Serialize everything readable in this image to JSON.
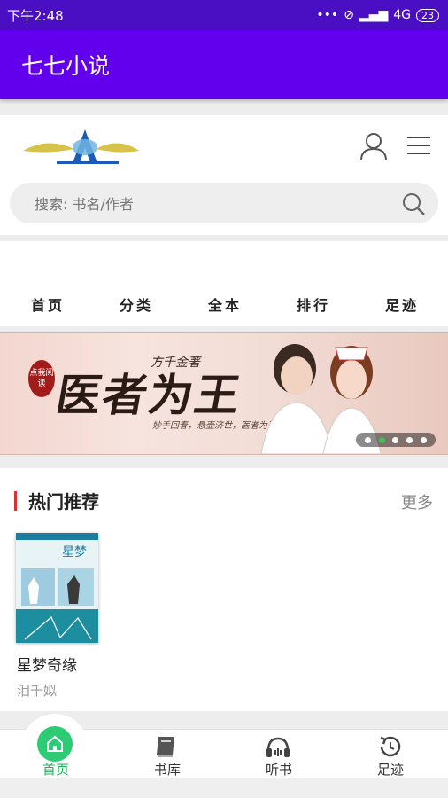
{
  "status_bar": {
    "time": "下午2:48",
    "network": "4G",
    "battery": "23"
  },
  "app_bar": {
    "title": "七七小说"
  },
  "search": {
    "placeholder": "搜索: 书名/作者"
  },
  "nav": {
    "items": [
      {
        "label": "首页"
      },
      {
        "label": "分类"
      },
      {
        "label": "全本"
      },
      {
        "label": "排行"
      },
      {
        "label": "足迹"
      }
    ]
  },
  "banner": {
    "title": "医者为王",
    "author": "方千金著",
    "slogan": "妙手回春，悬壶济世，医者为王",
    "badge": "点我阅读",
    "dot_count": 5,
    "active_dot": 1
  },
  "hot": {
    "title": "热门推荐",
    "more_label": "更多",
    "books": [
      {
        "title": "星梦奇缘",
        "author": "泪千姒"
      }
    ]
  },
  "tab_bar": {
    "items": [
      {
        "label": "首页",
        "icon": "home-icon",
        "active": true
      },
      {
        "label": "书库",
        "icon": "book-icon",
        "active": false
      },
      {
        "label": "听书",
        "icon": "headphones-icon",
        "active": false
      },
      {
        "label": "足迹",
        "icon": "history-icon",
        "active": false
      }
    ],
    "accent_color": "#1fb65a"
  },
  "colors": {
    "status_bar": "#4a0fc2",
    "app_bar": "#6200ee",
    "hot_accent": "#d93232"
  }
}
